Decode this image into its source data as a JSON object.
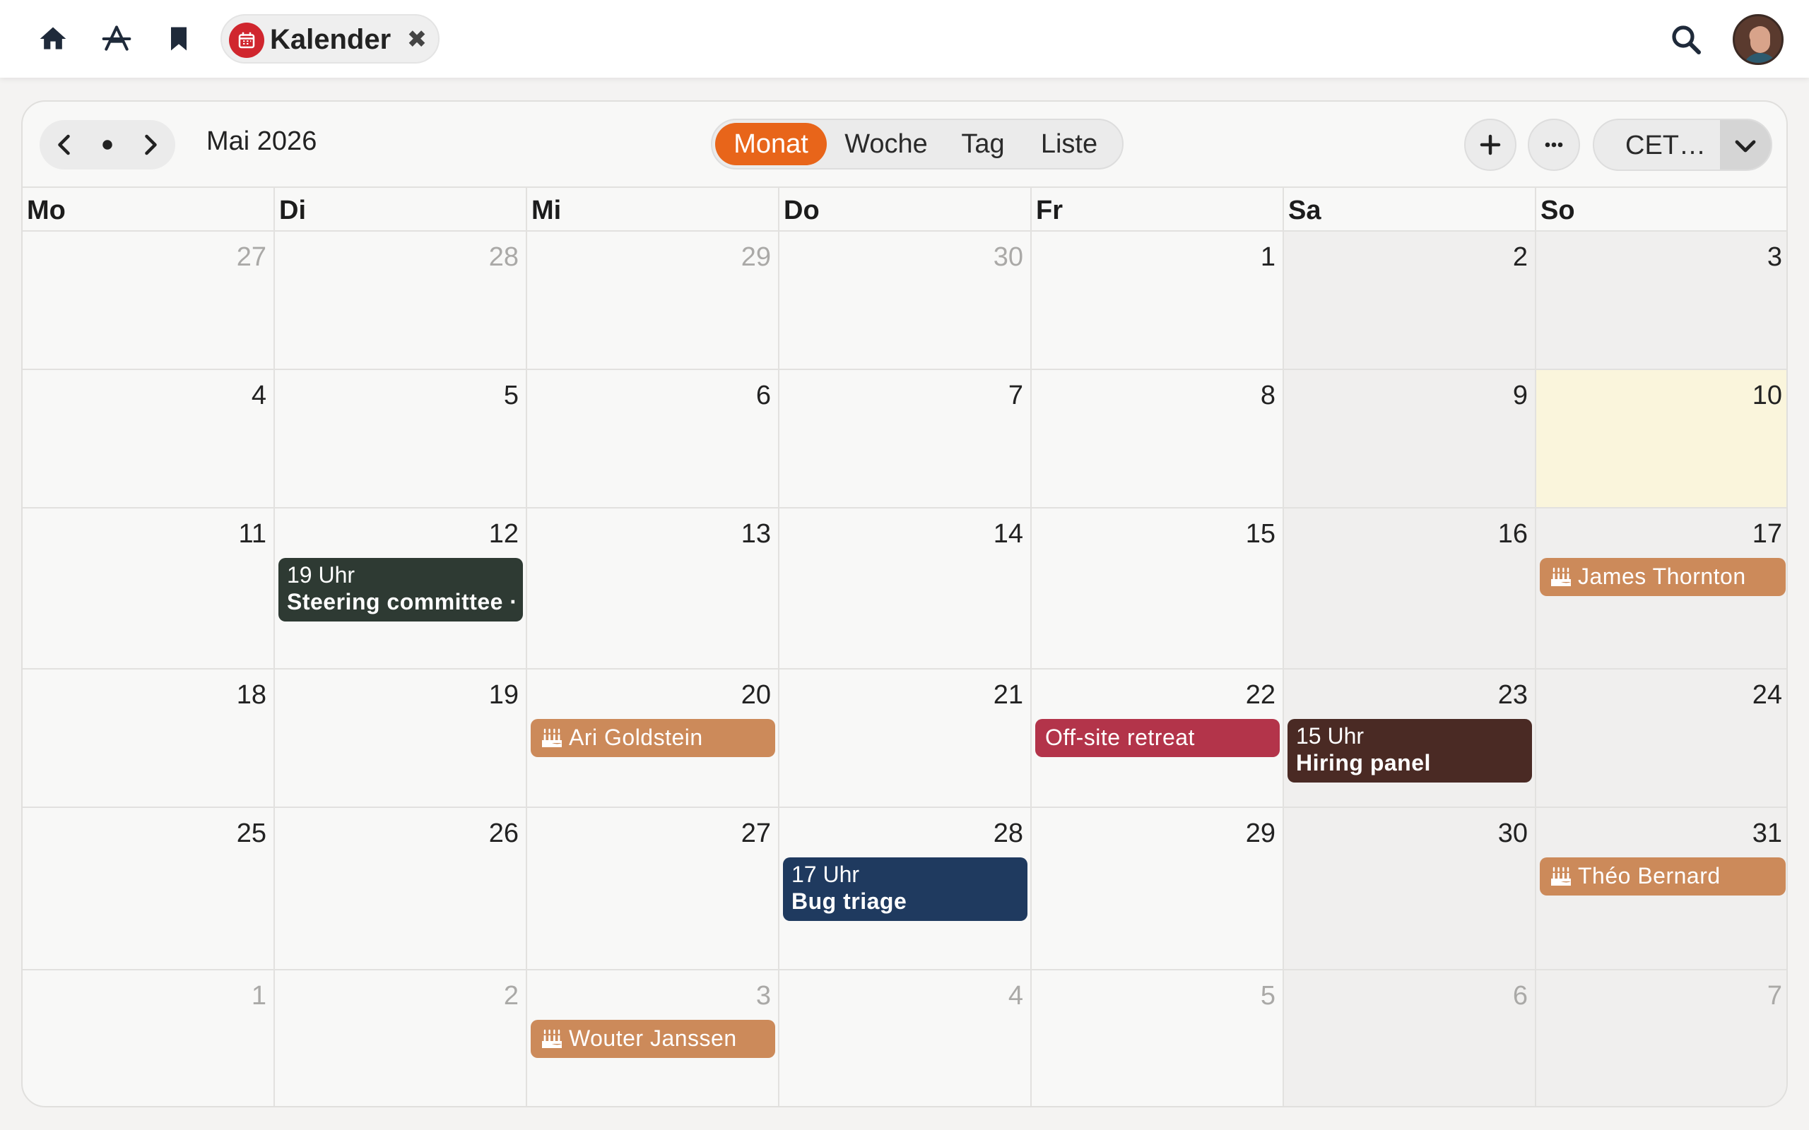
{
  "topbar": {
    "icons": [
      "home-icon",
      "apps-icon",
      "bookmark-icon",
      "search-icon"
    ],
    "tab": {
      "label": "Kalender",
      "close": "✖",
      "icon": "calendar-icon"
    }
  },
  "toolbar": {
    "month_title": "Mai 2026",
    "views": [
      "Monat",
      "Woche",
      "Tag",
      "Liste"
    ],
    "active_view": "Monat",
    "timezone": "CET…",
    "add_label": "+",
    "more_label": "•••"
  },
  "weekdays": [
    "Mo",
    "Di",
    "Mi",
    "Do",
    "Fr",
    "Sa",
    "So"
  ],
  "weeks": [
    [
      "27",
      "28",
      "29",
      "30",
      "1",
      "2",
      "3"
    ],
    [
      "4",
      "5",
      "6",
      "7",
      "8",
      "9",
      "10"
    ],
    [
      "11",
      "12",
      "13",
      "14",
      "15",
      "16",
      "17"
    ],
    [
      "18",
      "19",
      "20",
      "21",
      "22",
      "23",
      "24"
    ],
    [
      "25",
      "26",
      "27",
      "28",
      "29",
      "30",
      "31"
    ],
    [
      "1",
      "2",
      "3",
      "4",
      "5",
      "6",
      "7"
    ]
  ],
  "events": {
    "steering": {
      "time": "19 Uhr",
      "title": "Steering committee ·",
      "color": "#2e3a33"
    },
    "james": {
      "title": "James Thornton",
      "color": "#cc8a5a"
    },
    "ari": {
      "title": "Ari Goldstein",
      "color": "#cc8a5a"
    },
    "offsite": {
      "title": "Off-site retreat",
      "color": "#b3344a"
    },
    "hiring": {
      "time": "15 Uhr",
      "title": "Hiring panel",
      "color": "#4a2a24"
    },
    "bug": {
      "time": "17 Uhr",
      "title": "Bug triage",
      "color": "#1f3a5f"
    },
    "theo": {
      "title": "Théo Bernard",
      "color": "#cc8a5a"
    },
    "wouter": {
      "title": "Wouter Janssen",
      "color": "#cc8a5a"
    }
  },
  "colors": {
    "accent": "#e8651a",
    "today": "#faf5dc",
    "tab_icon": "#d0262e"
  }
}
